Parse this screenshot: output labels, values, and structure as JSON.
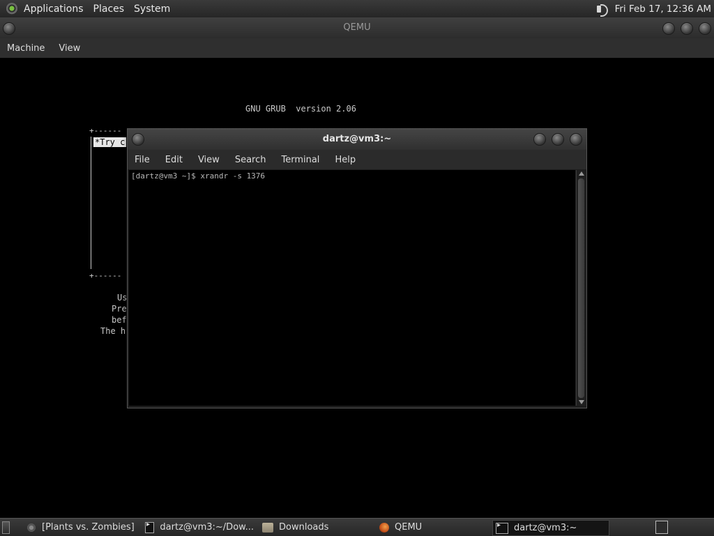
{
  "top_panel": {
    "menus": [
      "Applications",
      "Places",
      "System"
    ],
    "clock": "Fri Feb 17, 12:36 AM"
  },
  "qemu": {
    "title": "QEMU",
    "menus": [
      "Machine",
      "View"
    ]
  },
  "grub": {
    "header": "GNU GRUB  version 2.06",
    "menu_border_top": "+------",
    "menu_border_bottom": "+------",
    "selected_entry": "*Try c",
    "help_lines": [
      "Us",
      "Pre",
      "bef",
      "The h"
    ]
  },
  "terminal": {
    "title": "dartz@vm3:~",
    "menus": [
      "File",
      "Edit",
      "View",
      "Search",
      "Terminal",
      "Help"
    ],
    "prompt_line": "[dartz@vm3 ~]$ xrandr -s 1376"
  },
  "taskbar": {
    "tasks": [
      {
        "label": "[Plants vs. Zombies]",
        "icon": "gear-icon"
      },
      {
        "label": "dartz@vm3:~/Dow...",
        "icon": "terminal-icon"
      },
      {
        "label": "Downloads",
        "icon": "folder-icon"
      },
      {
        "label": "QEMU",
        "icon": "qemu-icon"
      },
      {
        "label": "dartz@vm3:~",
        "icon": "terminal-icon",
        "active": true
      }
    ]
  }
}
